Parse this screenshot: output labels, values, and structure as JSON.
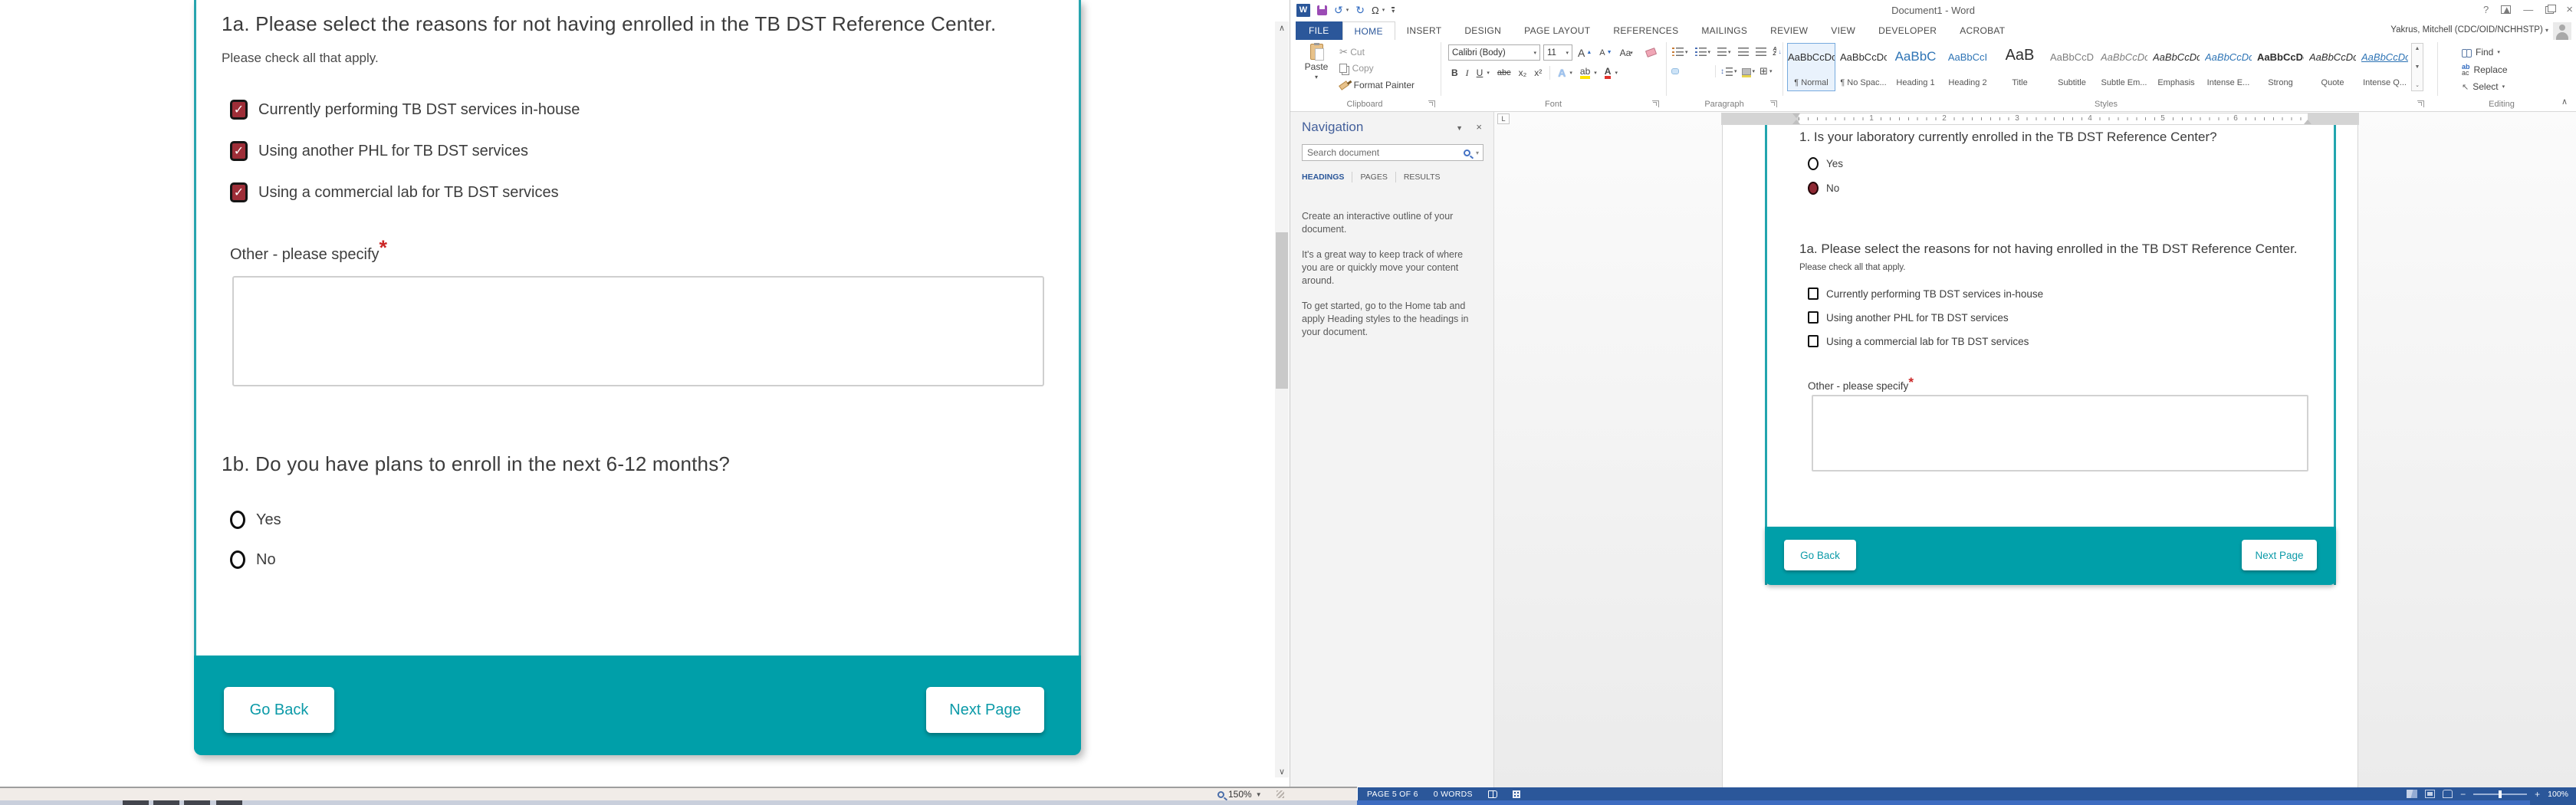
{
  "left_app": {
    "form": {
      "q1a_title": "1a. Please select the reasons for not having enrolled in the TB DST Reference Center.",
      "q1a_hint": "Please check all that apply.",
      "check_glyph": "✓",
      "checkboxes": [
        {
          "label": "Currently performing TB DST services in-house",
          "checked": true
        },
        {
          "label": "Using another PHL for TB DST services",
          "checked": true
        },
        {
          "label": "Using a commercial lab for TB DST services",
          "checked": true
        }
      ],
      "other_label": "Other - please specify",
      "required_star": "*",
      "other_value": "",
      "q1b_title": "1b. Do you have plans to enroll in the next 6-12 months?",
      "radio_options": [
        "Yes",
        "No"
      ],
      "go_back_label": "Go Back",
      "next_page_label": "Next Page"
    },
    "status_bar": {
      "zoom_level": "150%"
    }
  },
  "word": {
    "title_bar": {
      "title": "Document1 - Word",
      "qat": {
        "logo": "W",
        "undo": "↺",
        "redo": "↻",
        "symbol": "Ω"
      },
      "controls": {
        "help": "?",
        "minimize": "—",
        "close": "×"
      }
    },
    "tabs": [
      "FILE",
      "HOME",
      "INSERT",
      "DESIGN",
      "PAGE LAYOUT",
      "REFERENCES",
      "MAILINGS",
      "REVIEW",
      "VIEW",
      "DEVELOPER",
      "ACROBAT"
    ],
    "user_name": "Yakrus, Mitchell (CDC/OID/NCHHSTP)",
    "ribbon": {
      "clipboard": {
        "label": "Clipboard",
        "paste": "Paste",
        "cut": "Cut",
        "copy": "Copy",
        "format_painter": "Format Painter"
      },
      "font": {
        "label": "Font",
        "name": "Calibri (Body)",
        "size": "11",
        "bold": "B",
        "italic": "I",
        "underline": "U",
        "strike": "abc",
        "subscript": "x₂",
        "superscript": "x²",
        "grow": "A",
        "shrink": "A",
        "case": "Aa",
        "effects": "A",
        "highlight": "ab",
        "color": "A"
      },
      "paragraph": {
        "label": "Paragraph",
        "sort_a": "A",
        "sort_z": "Z",
        "pilcrow": "¶"
      },
      "styles": {
        "label": "Styles",
        "items": [
          {
            "sample": "AaBbCcDc",
            "name": "¶ Normal"
          },
          {
            "sample": "AaBbCcDc",
            "name": "¶ No Spac..."
          },
          {
            "sample": "AaBbC",
            "name": "Heading 1"
          },
          {
            "sample": "AaBbCcI",
            "name": "Heading 2"
          },
          {
            "sample": "AaB",
            "name": "Title"
          },
          {
            "sample": "AaBbCcD",
            "name": "Subtitle"
          },
          {
            "sample": "AaBbCcDc",
            "name": "Subtle Em..."
          },
          {
            "sample": "AaBbCcDc",
            "name": "Emphasis"
          },
          {
            "sample": "AaBbCcDc",
            "name": "Intense E..."
          },
          {
            "sample": "AaBbCcDc",
            "name": "Strong"
          },
          {
            "sample": "AaBbCcDc",
            "name": "Quote"
          },
          {
            "sample": "AaBbCcDc",
            "name": "Intense Q..."
          }
        ]
      },
      "editing": {
        "label": "Editing",
        "find": "Find",
        "replace": "Replace",
        "select": "Select"
      }
    },
    "nav_pane": {
      "title": "Navigation",
      "search_placeholder": "Search document",
      "tabs": [
        "HEADINGS",
        "PAGES",
        "RESULTS"
      ],
      "paragraphs": [
        "Create an interactive outline of your document.",
        "It's a great way to keep track of where you are or quickly move your content around.",
        "To get started, go to the Home tab and apply Heading styles to the headings in your document."
      ]
    },
    "ruler_numbers": [
      "1",
      "2",
      "3",
      "4",
      "5",
      "6"
    ],
    "document": {
      "q1_title": "1. Is your laboratory currently enrolled in the TB DST Reference Center?",
      "radio_options": [
        "Yes",
        "No"
      ],
      "selected_radio": "No",
      "q1a_title": "1a. Please select the reasons for not having enrolled in the TB DST Reference Center.",
      "q1a_hint": "Please check all that apply.",
      "checkboxes": [
        "Currently performing TB DST services in-house",
        "Using another PHL for TB DST services",
        "Using a commercial lab for TB DST services"
      ],
      "other_label": "Other - please specify",
      "required_star": "*",
      "go_back_label": "Go Back",
      "next_page_label": "Next Page"
    },
    "status_bar": {
      "page_info": "PAGE 5 OF 6",
      "word_count": "0 WORDS",
      "zoom_level": "100%"
    }
  }
}
